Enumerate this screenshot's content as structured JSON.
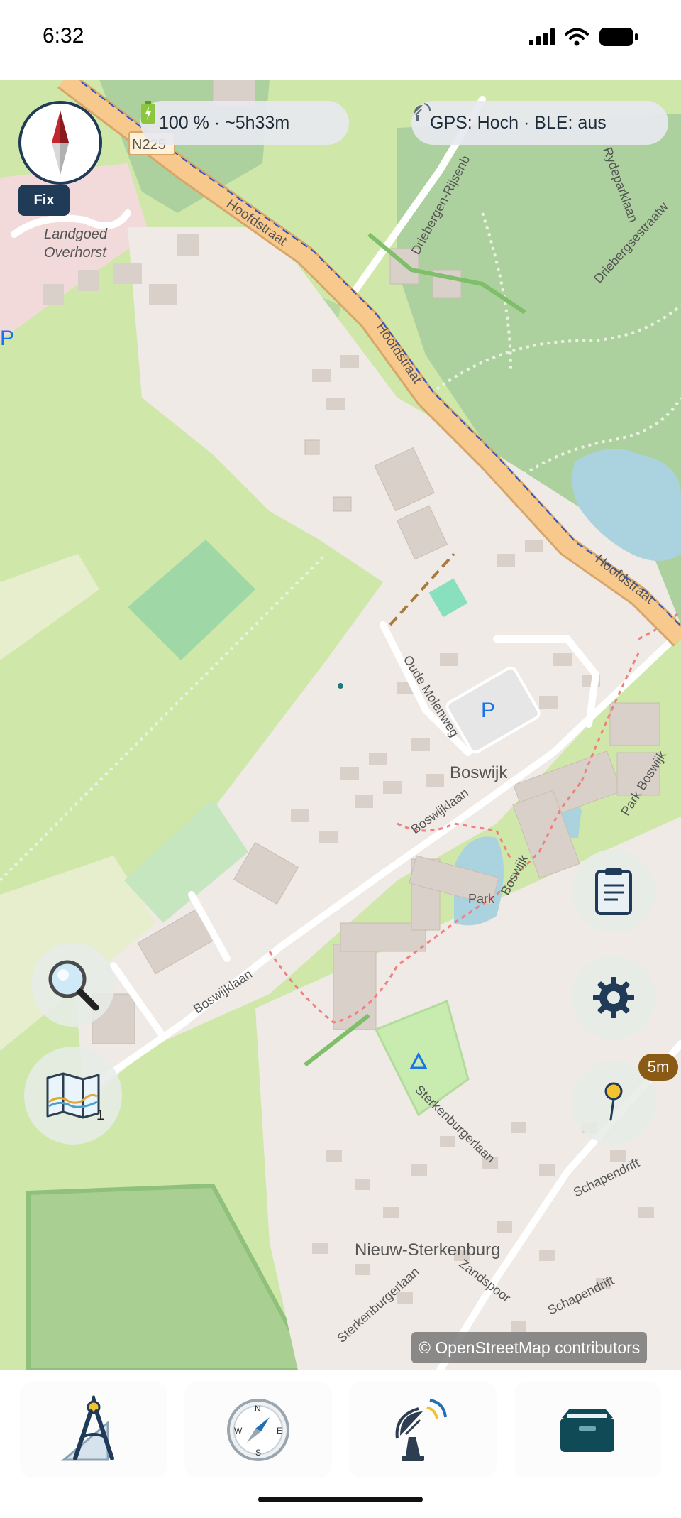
{
  "status_bar": {
    "time": "6:32"
  },
  "map_overlay": {
    "battery_pill": "100 % · ~5h33m",
    "gps_pill": "GPS: Hoch · BLE: aus",
    "fix_badge": "Fix",
    "distance_badge": "5m",
    "layers_count": "1",
    "attribution": "© OpenStreetMap contributors"
  },
  "map_labels": {
    "road_n225": "N225",
    "landgoed": "Landgoed",
    "overhorst": "Overhorst",
    "hoofdstraat_1": "Hoofdstraat",
    "hoofdstraat_2": "Hoofdstraat",
    "hoofdstraat_3": "Hoofdstraat",
    "driebergen_rijsenburg": "Driebergen-Rijsenb",
    "rydeparklaan": "Rydeparklaan",
    "driebergsestraatweg": "Driebergsestraatw",
    "oude_molenweg": "Oude Molenweg",
    "boswijk": "Boswijk",
    "boswijklaan_1": "Boswijklaan",
    "boswijklaan_2": "Boswijklaan",
    "park": "Park",
    "boswijk_road": "Boswijk",
    "park_boswijk": "Park Boswijk",
    "sterkenburgerlaan_1": "Sterkenburgerlaan",
    "sterkenburgerlaan_2": "Sterkenburgerlaan",
    "nieuw_sterkenburg": "Nieuw-Sterkenburg",
    "zandspoor": "Zandspoor",
    "schapendrift_1": "Schapendrift",
    "schapendrift_2": "Schapendrift",
    "parking": "P"
  },
  "colors": {
    "accent_navy": "#1f3b57",
    "main_road": "#f7c98c",
    "meadow": "#cfe8a9",
    "forest": "#add19e",
    "water": "#aad3df",
    "residential": "#efeae5",
    "badge_brown": "#8a5a17"
  },
  "icons": {
    "battery": "battery-icon",
    "gps": "satellite-dish-icon",
    "compass": "compass-needle-icon",
    "search": "magnifier-icon",
    "layers": "folded-map-icon",
    "checklist": "clipboard-icon",
    "settings": "gear-icon",
    "pin": "map-pin-icon",
    "tab_measure": "drafting-compass-icon",
    "tab_navigate": "compass-icon",
    "tab_gps": "satellite-dish-icon",
    "tab_files": "file-box-icon"
  }
}
